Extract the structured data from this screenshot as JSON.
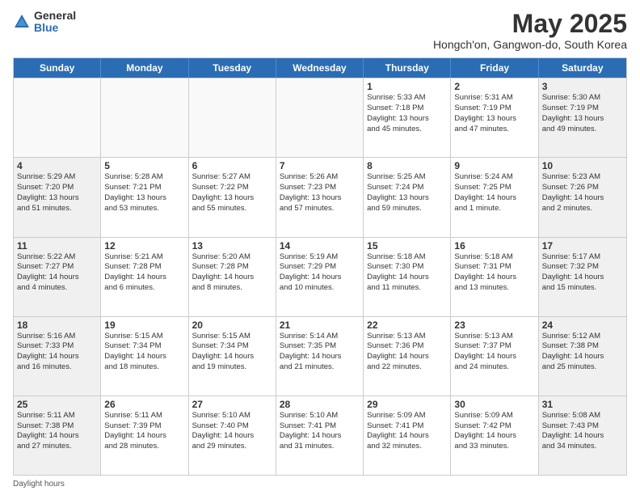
{
  "logo": {
    "general": "General",
    "blue": "Blue"
  },
  "title": {
    "month_year": "May 2025",
    "location": "Hongch'on, Gangwon-do, South Korea"
  },
  "days_of_week": [
    "Sunday",
    "Monday",
    "Tuesday",
    "Wednesday",
    "Thursday",
    "Friday",
    "Saturday"
  ],
  "footer_label": "Daylight hours",
  "weeks": [
    [
      {
        "day": "",
        "info": "",
        "empty": true
      },
      {
        "day": "",
        "info": "",
        "empty": true
      },
      {
        "day": "",
        "info": "",
        "empty": true
      },
      {
        "day": "",
        "info": "",
        "empty": true
      },
      {
        "day": "1",
        "info": "Sunrise: 5:33 AM\nSunset: 7:18 PM\nDaylight: 13 hours\nand 45 minutes.",
        "shaded": false
      },
      {
        "day": "2",
        "info": "Sunrise: 5:31 AM\nSunset: 7:19 PM\nDaylight: 13 hours\nand 47 minutes.",
        "shaded": false
      },
      {
        "day": "3",
        "info": "Sunrise: 5:30 AM\nSunset: 7:19 PM\nDaylight: 13 hours\nand 49 minutes.",
        "shaded": true
      }
    ],
    [
      {
        "day": "4",
        "info": "Sunrise: 5:29 AM\nSunset: 7:20 PM\nDaylight: 13 hours\nand 51 minutes.",
        "shaded": true
      },
      {
        "day": "5",
        "info": "Sunrise: 5:28 AM\nSunset: 7:21 PM\nDaylight: 13 hours\nand 53 minutes.",
        "shaded": false
      },
      {
        "day": "6",
        "info": "Sunrise: 5:27 AM\nSunset: 7:22 PM\nDaylight: 13 hours\nand 55 minutes.",
        "shaded": false
      },
      {
        "day": "7",
        "info": "Sunrise: 5:26 AM\nSunset: 7:23 PM\nDaylight: 13 hours\nand 57 minutes.",
        "shaded": false
      },
      {
        "day": "8",
        "info": "Sunrise: 5:25 AM\nSunset: 7:24 PM\nDaylight: 13 hours\nand 59 minutes.",
        "shaded": false
      },
      {
        "day": "9",
        "info": "Sunrise: 5:24 AM\nSunset: 7:25 PM\nDaylight: 14 hours\nand 1 minute.",
        "shaded": false
      },
      {
        "day": "10",
        "info": "Sunrise: 5:23 AM\nSunset: 7:26 PM\nDaylight: 14 hours\nand 2 minutes.",
        "shaded": true
      }
    ],
    [
      {
        "day": "11",
        "info": "Sunrise: 5:22 AM\nSunset: 7:27 PM\nDaylight: 14 hours\nand 4 minutes.",
        "shaded": true
      },
      {
        "day": "12",
        "info": "Sunrise: 5:21 AM\nSunset: 7:28 PM\nDaylight: 14 hours\nand 6 minutes.",
        "shaded": false
      },
      {
        "day": "13",
        "info": "Sunrise: 5:20 AM\nSunset: 7:28 PM\nDaylight: 14 hours\nand 8 minutes.",
        "shaded": false
      },
      {
        "day": "14",
        "info": "Sunrise: 5:19 AM\nSunset: 7:29 PM\nDaylight: 14 hours\nand 10 minutes.",
        "shaded": false
      },
      {
        "day": "15",
        "info": "Sunrise: 5:18 AM\nSunset: 7:30 PM\nDaylight: 14 hours\nand 11 minutes.",
        "shaded": false
      },
      {
        "day": "16",
        "info": "Sunrise: 5:18 AM\nSunset: 7:31 PM\nDaylight: 14 hours\nand 13 minutes.",
        "shaded": false
      },
      {
        "day": "17",
        "info": "Sunrise: 5:17 AM\nSunset: 7:32 PM\nDaylight: 14 hours\nand 15 minutes.",
        "shaded": true
      }
    ],
    [
      {
        "day": "18",
        "info": "Sunrise: 5:16 AM\nSunset: 7:33 PM\nDaylight: 14 hours\nand 16 minutes.",
        "shaded": true
      },
      {
        "day": "19",
        "info": "Sunrise: 5:15 AM\nSunset: 7:34 PM\nDaylight: 14 hours\nand 18 minutes.",
        "shaded": false
      },
      {
        "day": "20",
        "info": "Sunrise: 5:15 AM\nSunset: 7:34 PM\nDaylight: 14 hours\nand 19 minutes.",
        "shaded": false
      },
      {
        "day": "21",
        "info": "Sunrise: 5:14 AM\nSunset: 7:35 PM\nDaylight: 14 hours\nand 21 minutes.",
        "shaded": false
      },
      {
        "day": "22",
        "info": "Sunrise: 5:13 AM\nSunset: 7:36 PM\nDaylight: 14 hours\nand 22 minutes.",
        "shaded": false
      },
      {
        "day": "23",
        "info": "Sunrise: 5:13 AM\nSunset: 7:37 PM\nDaylight: 14 hours\nand 24 minutes.",
        "shaded": false
      },
      {
        "day": "24",
        "info": "Sunrise: 5:12 AM\nSunset: 7:38 PM\nDaylight: 14 hours\nand 25 minutes.",
        "shaded": true
      }
    ],
    [
      {
        "day": "25",
        "info": "Sunrise: 5:11 AM\nSunset: 7:38 PM\nDaylight: 14 hours\nand 27 minutes.",
        "shaded": true
      },
      {
        "day": "26",
        "info": "Sunrise: 5:11 AM\nSunset: 7:39 PM\nDaylight: 14 hours\nand 28 minutes.",
        "shaded": false
      },
      {
        "day": "27",
        "info": "Sunrise: 5:10 AM\nSunset: 7:40 PM\nDaylight: 14 hours\nand 29 minutes.",
        "shaded": false
      },
      {
        "day": "28",
        "info": "Sunrise: 5:10 AM\nSunset: 7:41 PM\nDaylight: 14 hours\nand 31 minutes.",
        "shaded": false
      },
      {
        "day": "29",
        "info": "Sunrise: 5:09 AM\nSunset: 7:41 PM\nDaylight: 14 hours\nand 32 minutes.",
        "shaded": false
      },
      {
        "day": "30",
        "info": "Sunrise: 5:09 AM\nSunset: 7:42 PM\nDaylight: 14 hours\nand 33 minutes.",
        "shaded": false
      },
      {
        "day": "31",
        "info": "Sunrise: 5:08 AM\nSunset: 7:43 PM\nDaylight: 14 hours\nand 34 minutes.",
        "shaded": true
      }
    ]
  ]
}
